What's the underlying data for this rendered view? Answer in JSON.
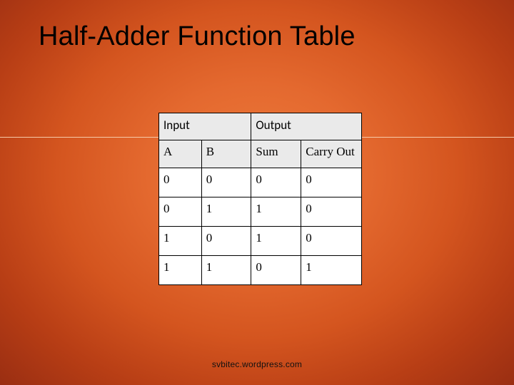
{
  "title": "Half-Adder Function Table",
  "footer": "svbitec.wordpress.com",
  "table": {
    "group_headers": {
      "input": "Input",
      "output": "Output"
    },
    "col_headers": {
      "a": "A",
      "b": "B",
      "sum": "Sum",
      "carry": "Carry Out"
    },
    "rows": [
      {
        "a": "0",
        "b": "0",
        "sum": "0",
        "carry": "0"
      },
      {
        "a": "0",
        "b": "1",
        "sum": "1",
        "carry": "0"
      },
      {
        "a": "1",
        "b": "0",
        "sum": "1",
        "carry": "0"
      },
      {
        "a": "1",
        "b": "1",
        "sum": "0",
        "carry": "1"
      }
    ]
  },
  "chart_data": {
    "type": "table",
    "title": "Half-Adder Function Table",
    "columns": [
      "A",
      "B",
      "Sum",
      "Carry Out"
    ],
    "column_groups": {
      "Input": [
        "A",
        "B"
      ],
      "Output": [
        "Sum",
        "Carry Out"
      ]
    },
    "data": [
      [
        0,
        0,
        0,
        0
      ],
      [
        0,
        1,
        1,
        0
      ],
      [
        1,
        0,
        1,
        0
      ],
      [
        1,
        1,
        0,
        1
      ]
    ]
  }
}
